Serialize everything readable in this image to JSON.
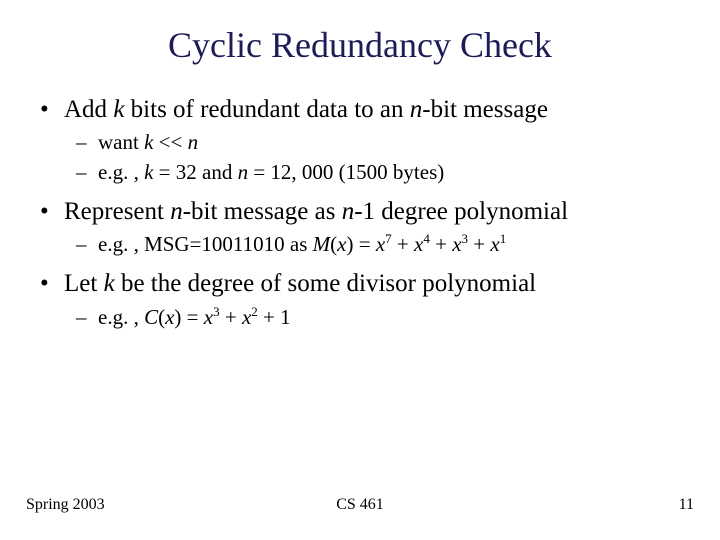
{
  "title": "Cyclic Redundancy Check",
  "bullets": {
    "b1": {
      "pre": "Add ",
      "k": "k",
      "mid1": " bits of redundant data to an ",
      "n": "n",
      "post": "-bit message"
    },
    "b1s1": {
      "pre": "want ",
      "k": "k",
      "op": " << ",
      "n": "n"
    },
    "b1s2": {
      "pre": "e.g. , ",
      "k": "k",
      "eq1": " = 32 and ",
      "n": "n",
      "eq2": " = 12, 000 (1500 bytes)"
    },
    "b2": {
      "pre": "Represent ",
      "n1": "n",
      "mid": "-bit message as ",
      "n2": "n",
      "post": "-1 degree polynomial"
    },
    "b2s1": {
      "pre": "e.g. , MSG=10011010 as ",
      "M": "M",
      "x": "x",
      "e7": "7",
      "e4": "4",
      "e3": "3",
      "e1": "1",
      "plus": " + ",
      "lp": "(",
      "rp": ")",
      "eq": " = "
    },
    "b3": {
      "pre": "Let ",
      "k": "k",
      "post": " be the degree of some divisor polynomial"
    },
    "b3s1": {
      "pre": "e.g. , ",
      "C": "C",
      "x": "x",
      "e3": "3",
      "e2": "2",
      "plus": " + ",
      "one": "1",
      "lp": "(",
      "rp": ")",
      "eq": " = "
    }
  },
  "footer": {
    "left": "Spring 2003",
    "center": "CS 461",
    "right": "11"
  }
}
